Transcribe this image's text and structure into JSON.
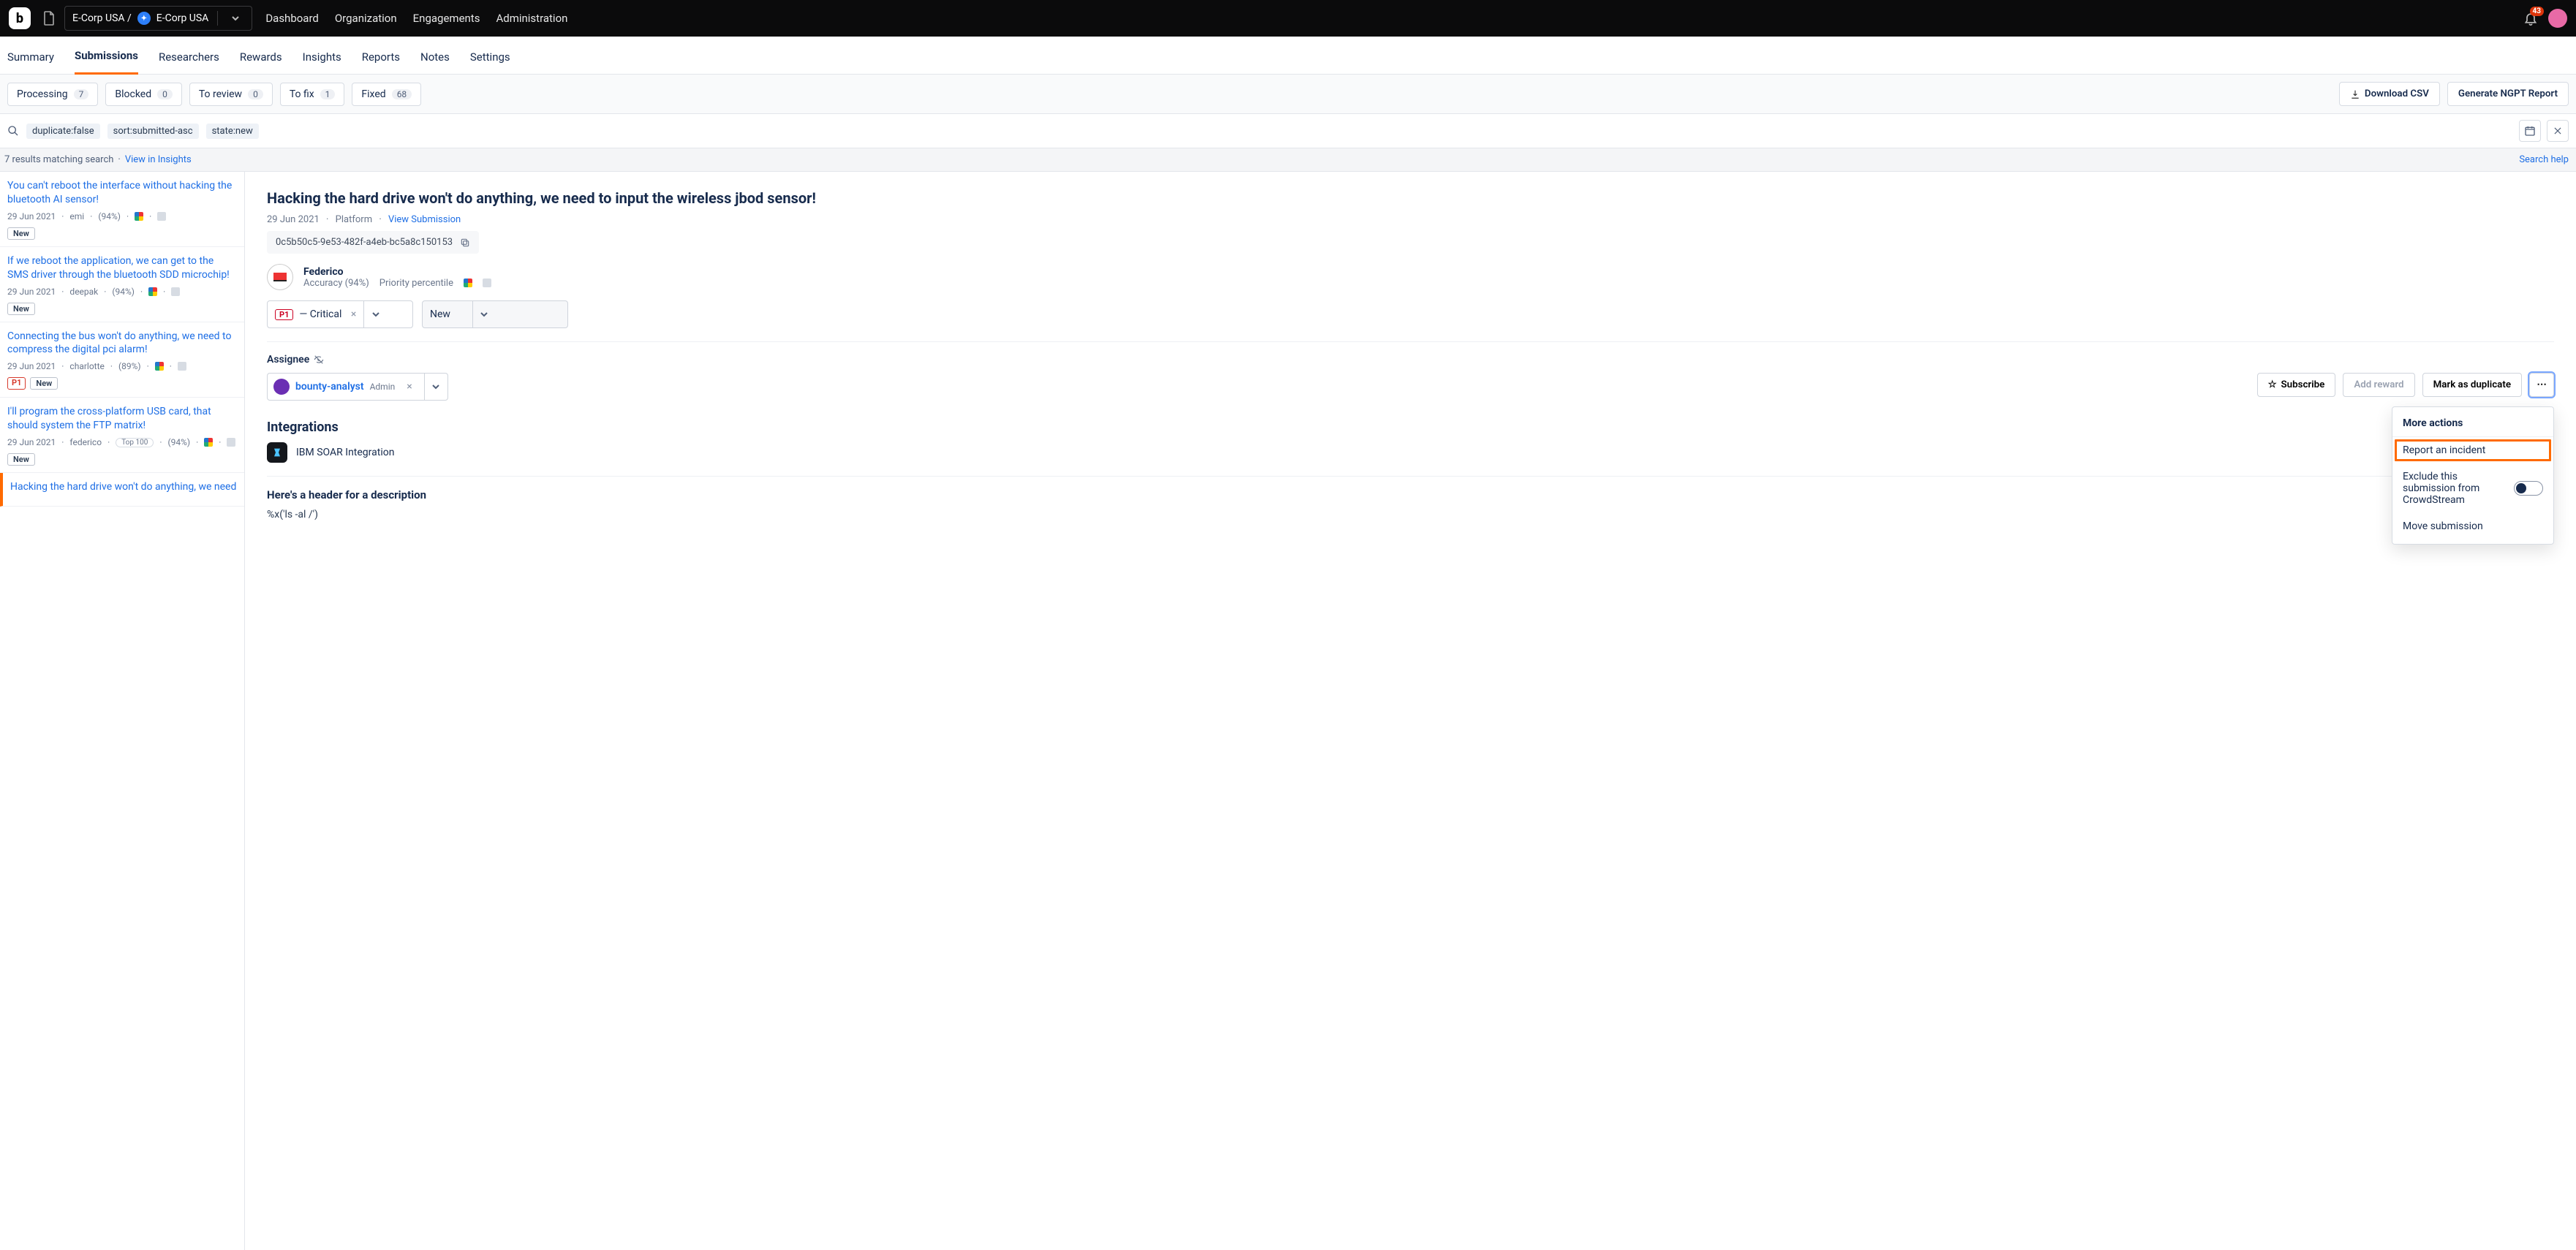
{
  "topbar": {
    "org_path_prefix": "E-Corp USA /",
    "org_name": "E-Corp USA",
    "nav": [
      "Dashboard",
      "Organization",
      "Engagements",
      "Administration"
    ],
    "notification_count": "43"
  },
  "subtabs": [
    "Summary",
    "Submissions",
    "Researchers",
    "Rewards",
    "Insights",
    "Reports",
    "Notes",
    "Settings"
  ],
  "active_subtab": "Submissions",
  "filters": [
    {
      "label": "Processing",
      "count": "7"
    },
    {
      "label": "Blocked",
      "count": "0"
    },
    {
      "label": "To review",
      "count": "0"
    },
    {
      "label": "To fix",
      "count": "1"
    },
    {
      "label": "Fixed",
      "count": "68"
    }
  ],
  "buttons": {
    "download_csv": "Download CSV",
    "generate_report": "Generate NGPT Report"
  },
  "search": {
    "chips": [
      "duplicate:false",
      "sort:submitted-asc",
      "state:new"
    ]
  },
  "results_bar": {
    "text": "7 results matching search",
    "view_link": "View in Insights",
    "help": "Search help"
  },
  "submissions": [
    {
      "title": "You can't reboot the interface without hacking the bluetooth AI sensor!",
      "date": "29 Jun 2021",
      "user": "emi",
      "accuracy": "(94%)",
      "badges": [
        "New"
      ]
    },
    {
      "title": "If we reboot the application, we can get to the SMS driver through the bluetooth SDD microchip!",
      "date": "29 Jun 2021",
      "user": "deepak",
      "accuracy": "(94%)",
      "badges": [
        "New"
      ]
    },
    {
      "title": "Connecting the bus won't do anything, we need to compress the digital pci alarm!",
      "date": "29 Jun 2021",
      "user": "charlotte",
      "accuracy": "(89%)",
      "badges": [
        "P1",
        "New"
      ]
    },
    {
      "title": "I'll program the cross-platform USB card, that should system the FTP matrix!",
      "date": "29 Jun 2021",
      "user": "federico",
      "accuracy": "(94%)",
      "top100": "Top 100",
      "badges": [
        "New"
      ]
    },
    {
      "title": "Hacking the hard drive won't do anything, we need",
      "date": "",
      "user": "",
      "accuracy": "",
      "badges": [],
      "selected": true
    }
  ],
  "detail": {
    "title": "Hacking the hard drive won't do anything, we need to input the wireless jbod sensor!",
    "date": "29 Jun 2021",
    "platform": "Platform",
    "view_link": "View Submission",
    "id": "0c5b50c5-9e53-482f-a4eb-bc5a8c150153",
    "author": {
      "name": "Federico",
      "accuracy": "Accuracy (94%)",
      "priority_label": "Priority percentile"
    },
    "priority": {
      "chip": "P1",
      "label": "— Critical"
    },
    "status": "New",
    "assignee_label": "Assignee",
    "assignee": {
      "name": "bounty-analyst",
      "role": "Admin"
    },
    "actions": {
      "subscribe": "Subscribe",
      "add_reward": "Add reward",
      "mark_dup": "Mark as duplicate"
    },
    "more_menu": {
      "title": "More actions",
      "report": "Report an incident",
      "exclude": "Exclude this submission from CrowdStream",
      "move": "Move submission"
    },
    "integrations_label": "Integrations",
    "integration_name": "IBM SOAR Integration",
    "desc_header": "Here's a header for a description",
    "desc_body": "%x('ls -al /')"
  }
}
